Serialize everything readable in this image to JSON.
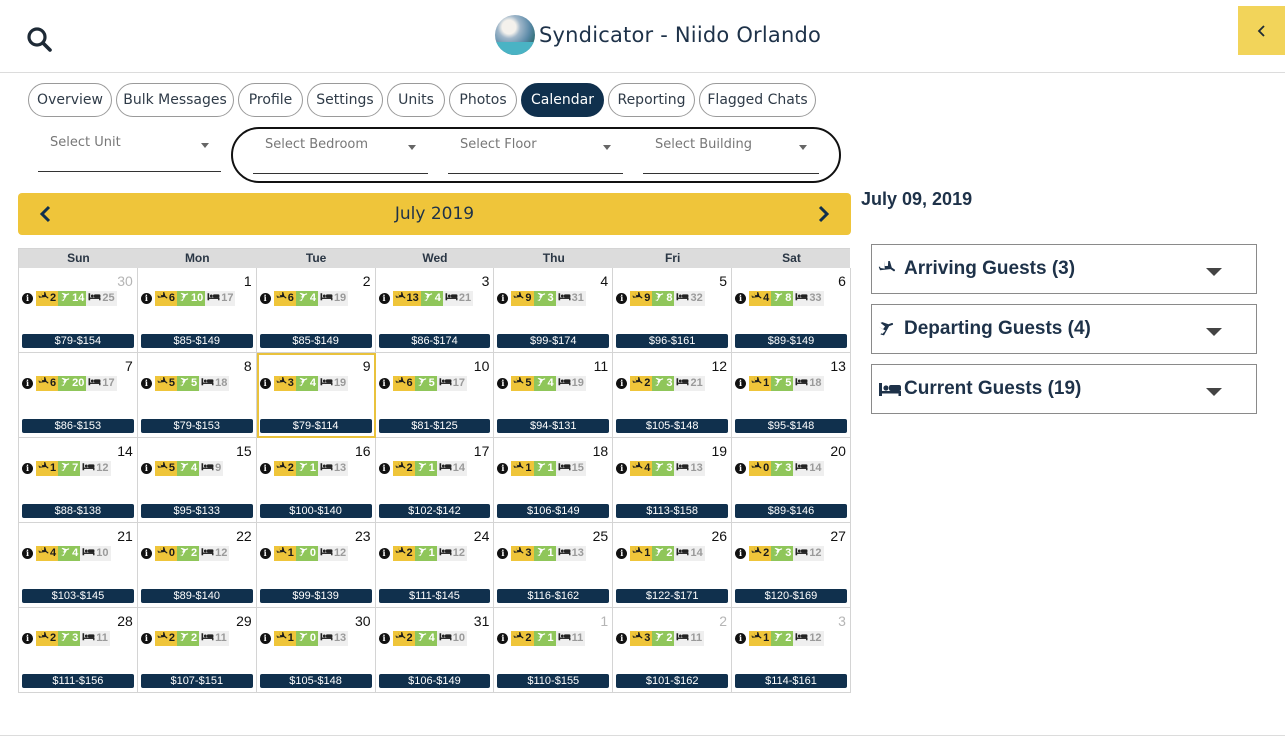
{
  "header": {
    "title": "Syndicator - Niido Orlando",
    "search_icon": "search-icon",
    "collapse_icon": "chevron-left-icon",
    "accent": "#f2d45a"
  },
  "tabs": [
    {
      "label": "Overview",
      "active": false
    },
    {
      "label": "Bulk Messages",
      "active": false
    },
    {
      "label": "Profile",
      "active": false
    },
    {
      "label": "Settings",
      "active": false
    },
    {
      "label": "Units",
      "active": false
    },
    {
      "label": "Photos",
      "active": false
    },
    {
      "label": "Calendar",
      "active": true
    },
    {
      "label": "Reporting",
      "active": false
    },
    {
      "label": "Flagged Chats",
      "active": false
    }
  ],
  "filters": {
    "unit": "Select Unit",
    "bedroom": "Select Bedroom",
    "floor": "Select Floor",
    "building": "Select Building"
  },
  "calendar": {
    "month_label": "July 2019",
    "weekdays": [
      "Sun",
      "Mon",
      "Tue",
      "Wed",
      "Thu",
      "Fri",
      "Sat"
    ],
    "colors": {
      "arriving": "#efc53a",
      "departing": "#8fc65a",
      "current": "#efefef",
      "price_bg": "#10304d"
    },
    "weeks": [
      [
        {
          "day": "30",
          "other": true,
          "arr": "2",
          "dep": "14",
          "cur": "25",
          "price": "$79-$154"
        },
        {
          "day": "1",
          "arr": "6",
          "dep": "10",
          "cur": "17",
          "price": "$85-$149"
        },
        {
          "day": "2",
          "arr": "6",
          "dep": "4",
          "cur": "19",
          "price": "$85-$149"
        },
        {
          "day": "3",
          "arr": "13",
          "dep": "4",
          "cur": "21",
          "price": "$86-$174"
        },
        {
          "day": "4",
          "arr": "9",
          "dep": "3",
          "cur": "31",
          "price": "$99-$174"
        },
        {
          "day": "5",
          "arr": "9",
          "dep": "8",
          "cur": "32",
          "price": "$96-$161"
        },
        {
          "day": "6",
          "arr": "4",
          "dep": "8",
          "cur": "33",
          "price": "$89-$149"
        }
      ],
      [
        {
          "day": "7",
          "arr": "6",
          "dep": "20",
          "cur": "17",
          "price": "$86-$153"
        },
        {
          "day": "8",
          "arr": "5",
          "dep": "5",
          "cur": "18",
          "price": "$79-$153"
        },
        {
          "day": "9",
          "today": true,
          "arr": "3",
          "dep": "4",
          "cur": "19",
          "price": "$79-$114"
        },
        {
          "day": "10",
          "arr": "6",
          "dep": "5",
          "cur": "17",
          "price": "$81-$125"
        },
        {
          "day": "11",
          "arr": "5",
          "dep": "4",
          "cur": "19",
          "price": "$94-$131"
        },
        {
          "day": "12",
          "arr": "2",
          "dep": "3",
          "cur": "21",
          "price": "$105-$148"
        },
        {
          "day": "13",
          "arr": "1",
          "dep": "5",
          "cur": "18",
          "price": "$95-$148"
        }
      ],
      [
        {
          "day": "14",
          "arr": "1",
          "dep": "7",
          "cur": "12",
          "price": "$88-$138"
        },
        {
          "day": "15",
          "arr": "5",
          "dep": "4",
          "cur": "9",
          "price": "$95-$133"
        },
        {
          "day": "16",
          "arr": "2",
          "dep": "1",
          "cur": "13",
          "price": "$100-$140"
        },
        {
          "day": "17",
          "arr": "2",
          "dep": "1",
          "cur": "14",
          "price": "$102-$142"
        },
        {
          "day": "18",
          "arr": "1",
          "dep": "1",
          "cur": "15",
          "price": "$106-$149"
        },
        {
          "day": "19",
          "arr": "4",
          "dep": "3",
          "cur": "13",
          "price": "$113-$158"
        },
        {
          "day": "20",
          "arr": "0",
          "dep": "3",
          "cur": "14",
          "price": "$89-$146"
        }
      ],
      [
        {
          "day": "21",
          "arr": "4",
          "dep": "4",
          "cur": "10",
          "price": "$103-$145"
        },
        {
          "day": "22",
          "arr": "0",
          "dep": "2",
          "cur": "12",
          "price": "$89-$140"
        },
        {
          "day": "23",
          "arr": "1",
          "dep": "0",
          "cur": "12",
          "price": "$99-$139"
        },
        {
          "day": "24",
          "arr": "2",
          "dep": "1",
          "cur": "12",
          "price": "$111-$145"
        },
        {
          "day": "25",
          "arr": "3",
          "dep": "1",
          "cur": "13",
          "price": "$116-$162"
        },
        {
          "day": "26",
          "arr": "1",
          "dep": "2",
          "cur": "14",
          "price": "$122-$171"
        },
        {
          "day": "27",
          "arr": "2",
          "dep": "3",
          "cur": "12",
          "price": "$120-$169"
        }
      ],
      [
        {
          "day": "28",
          "arr": "2",
          "dep": "3",
          "cur": "11",
          "price": "$111-$156"
        },
        {
          "day": "29",
          "arr": "2",
          "dep": "2",
          "cur": "11",
          "price": "$107-$151"
        },
        {
          "day": "30",
          "arr": "1",
          "dep": "0",
          "cur": "13",
          "price": "$105-$148"
        },
        {
          "day": "31",
          "arr": "2",
          "dep": "4",
          "cur": "10",
          "price": "$106-$149"
        },
        {
          "day": "1",
          "other": true,
          "arr": "2",
          "dep": "1",
          "cur": "11",
          "price": "$110-$155"
        },
        {
          "day": "2",
          "other": true,
          "arr": "3",
          "dep": "2",
          "cur": "11",
          "price": "$101-$162"
        },
        {
          "day": "3",
          "other": true,
          "arr": "1",
          "dep": "2",
          "cur": "12",
          "price": "$114-$161"
        }
      ]
    ]
  },
  "side_panel": {
    "date_heading": "July 09, 2019",
    "arriving": "Arriving Guests (3)",
    "departing": "Departing Guests (4)",
    "current": "Current Guests (19)"
  }
}
